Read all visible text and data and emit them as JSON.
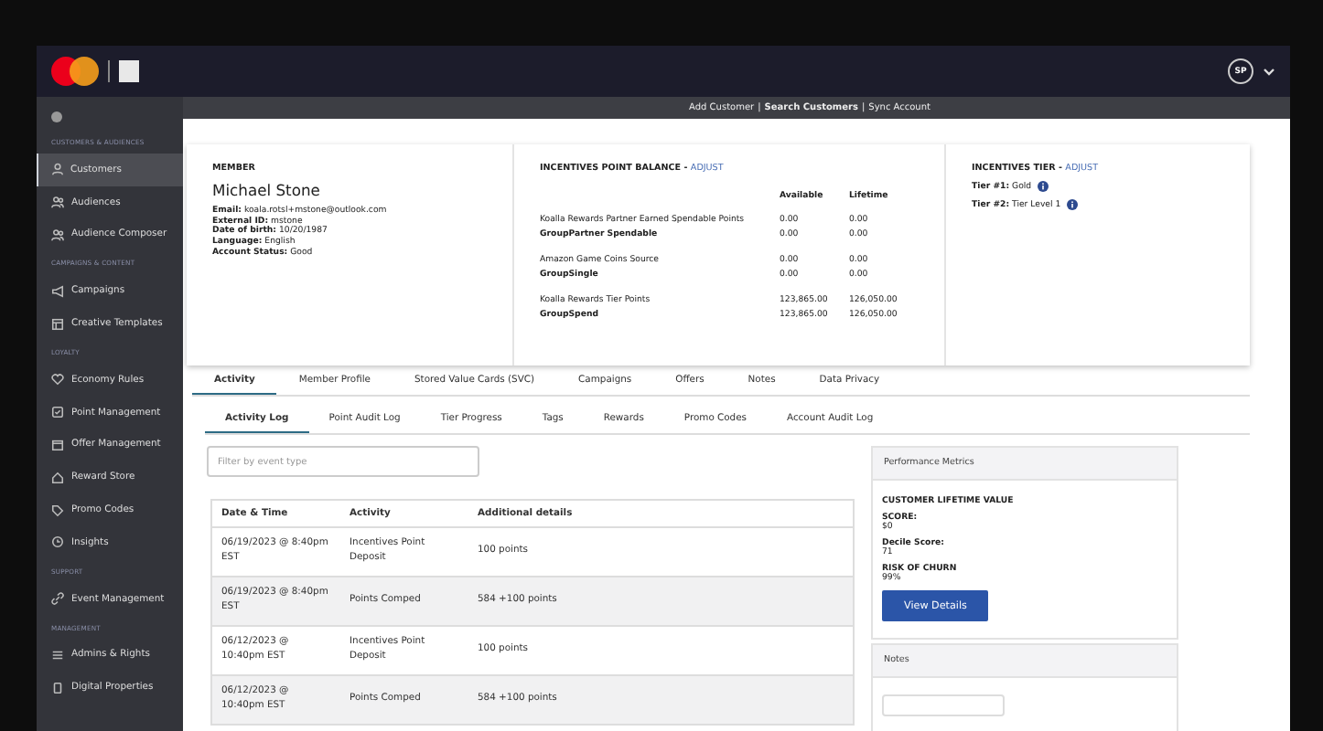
{
  "top_bar": {
    "avatar": "SP"
  },
  "sub_bar": {
    "links": [
      {
        "label": "Add Customer",
        "selected": false
      },
      {
        "label": "Search Customers",
        "selected": true
      },
      {
        "label": "Sync Account",
        "selected": false
      }
    ],
    "separators": [
      "|",
      "|"
    ]
  },
  "sidebar": {
    "sections": [
      {
        "title": "CUSTOMERS & AUDIENCES",
        "items": [
          {
            "label": "Customers",
            "selected": true
          },
          {
            "label": "Audiences",
            "selected": false
          },
          {
            "label": "Audience Composer",
            "selected": false
          }
        ]
      },
      {
        "title": "CAMPAIGNS & CONTENT",
        "items": [
          {
            "label": "Campaigns",
            "selected": false
          },
          {
            "label": "Creative Templates",
            "selected": false
          }
        ]
      },
      {
        "title": "LOYALTY",
        "items": [
          {
            "label": "Economy Rules",
            "selected": false
          },
          {
            "label": "Point Management",
            "selected": false
          },
          {
            "label": "Offer Management",
            "selected": false
          },
          {
            "label": "Reward Store",
            "selected": false
          },
          {
            "label": "Promo Codes",
            "selected": false
          },
          {
            "label": "Insights",
            "selected": false
          }
        ]
      },
      {
        "title": "SUPPORT",
        "items": [
          {
            "label": "Event Management",
            "selected": false
          }
        ]
      },
      {
        "title": "MANAGEMENT",
        "items": [
          {
            "label": "Admins & Rights",
            "selected": false
          },
          {
            "label": "Digital Properties",
            "selected": false
          }
        ]
      }
    ]
  },
  "member": {
    "heading": "MEMBER",
    "name": "Michael Stone",
    "fields": [
      {
        "label": "Email:",
        "value": "koala.rotsl+mstone@outlook.com"
      },
      {
        "label": "External ID:",
        "value": "mstone"
      },
      {
        "label": "Date of birth:",
        "value": "10/20/1987"
      },
      {
        "label": "Language:",
        "value": "English"
      },
      {
        "label": "Account Status:",
        "value": "Good"
      }
    ]
  },
  "point_balance": {
    "heading": "INCENTIVES POINT BALANCE -",
    "link": "ADJUST",
    "columns": [
      "Available",
      "Lifetime"
    ],
    "groups": [
      [
        {
          "label": "Koalla Rewards Partner Earned Spendable Points",
          "bold": false,
          "available": "0.00",
          "lifetime": "0.00"
        },
        {
          "label": "GroupPartner Spendable",
          "bold": true,
          "available": "0.00",
          "lifetime": "0.00"
        }
      ],
      [
        {
          "label": "Amazon Game Coins Source",
          "bold": false,
          "available": "0.00",
          "lifetime": "0.00"
        },
        {
          "label": "GroupSingle",
          "bold": true,
          "available": "0.00",
          "lifetime": "0.00"
        }
      ],
      [
        {
          "label": "Koalla Rewards Tier Points",
          "bold": false,
          "available": "123,865.00",
          "lifetime": "126,050.00"
        },
        {
          "label": "GroupSpend",
          "bold": true,
          "available": "123,865.00",
          "lifetime": "126,050.00"
        }
      ]
    ]
  },
  "tier": {
    "heading": "INCENTIVES TIER -",
    "link": "ADJUST",
    "tiers": [
      {
        "label": "Tier #1:",
        "value": "Gold"
      },
      {
        "label": "Tier #2:",
        "value": "Tier Level 1"
      }
    ]
  },
  "tabs": [
    {
      "label": "Activity",
      "selected": true
    },
    {
      "label": "Member Profile",
      "selected": false
    },
    {
      "label": "Stored Value Cards (SVC)",
      "selected": false
    },
    {
      "label": "Campaigns",
      "selected": false
    },
    {
      "label": "Offers",
      "selected": false
    },
    {
      "label": "Notes",
      "selected": false
    },
    {
      "label": "Data Privacy",
      "selected": false
    }
  ],
  "sub_tabs": [
    {
      "label": "Activity Log",
      "selected": true
    },
    {
      "label": "Point Audit Log",
      "selected": false
    },
    {
      "label": "Tier Progress",
      "selected": false
    },
    {
      "label": "Tags",
      "selected": false
    },
    {
      "label": "Rewards",
      "selected": false
    },
    {
      "label": "Promo Codes",
      "selected": false
    },
    {
      "label": "Account Audit Log",
      "selected": false
    }
  ],
  "filter": {
    "placeholder": "Filter by event type"
  },
  "table": {
    "columns": [
      "Date & Time",
      "Activity",
      "Additional details"
    ],
    "rows": [
      [
        "06/19/2023 @ 8:40pm EST",
        "Incentives Point Deposit",
        "100 points"
      ],
      [
        "06/19/2023 @ 8:40pm EST",
        "Points Comped",
        "584 +100 points"
      ],
      [
        "06/12/2023 @ 10:40pm EST",
        "Incentives Point Deposit",
        "100 points"
      ],
      [
        "06/12/2023 @ 10:40pm EST",
        "Points Comped",
        "584 +100 points"
      ]
    ]
  },
  "performance": {
    "title": "Performance Metrics",
    "heading": "CUSTOMER LIFETIME VALUE",
    "metrics": [
      {
        "label": "SCORE:",
        "value": "$0"
      },
      {
        "label": "Decile Score:",
        "value": "71"
      },
      {
        "label": "RISK OF CHURN",
        "value": "99%"
      }
    ],
    "button": "View Details"
  },
  "notes": {
    "title": "Notes"
  }
}
